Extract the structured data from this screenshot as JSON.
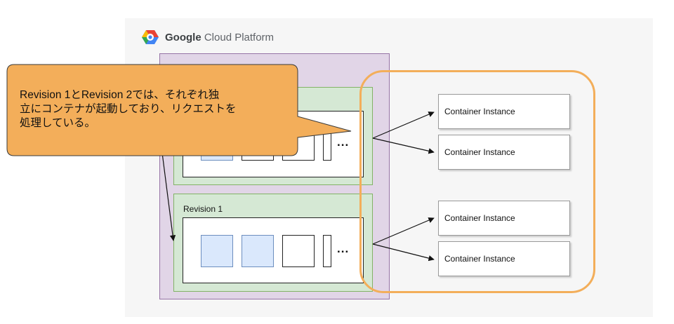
{
  "platform": {
    "brand": "Google",
    "product": "Cloud Platform",
    "logo_icon": "google-cloud-hexagon-icon",
    "logo_colors": [
      "#ea4335",
      "#fbbc05",
      "#34a853",
      "#4285f4"
    ]
  },
  "revisions": [
    {
      "label": ""
    },
    {
      "label": "Revision 1"
    }
  ],
  "ellipsis": "...",
  "instances": [
    {
      "label": "Container Instance"
    },
    {
      "label": "Container Instance"
    },
    {
      "label": "Container Instance"
    },
    {
      "label": "Container Instance"
    }
  ],
  "callout": {
    "lines": [
      "Revision 1とRevision 2では、それぞれ独",
      "立にコンテナが起動しており、リクエストを",
      "処理している。"
    ],
    "fill": "#f3ae5a"
  },
  "colors": {
    "service_fill": "#e1d5e7",
    "revision_fill": "#d5e8d4",
    "container_fill": "#dae8fc",
    "highlight_stroke": "#f3ae5a"
  }
}
